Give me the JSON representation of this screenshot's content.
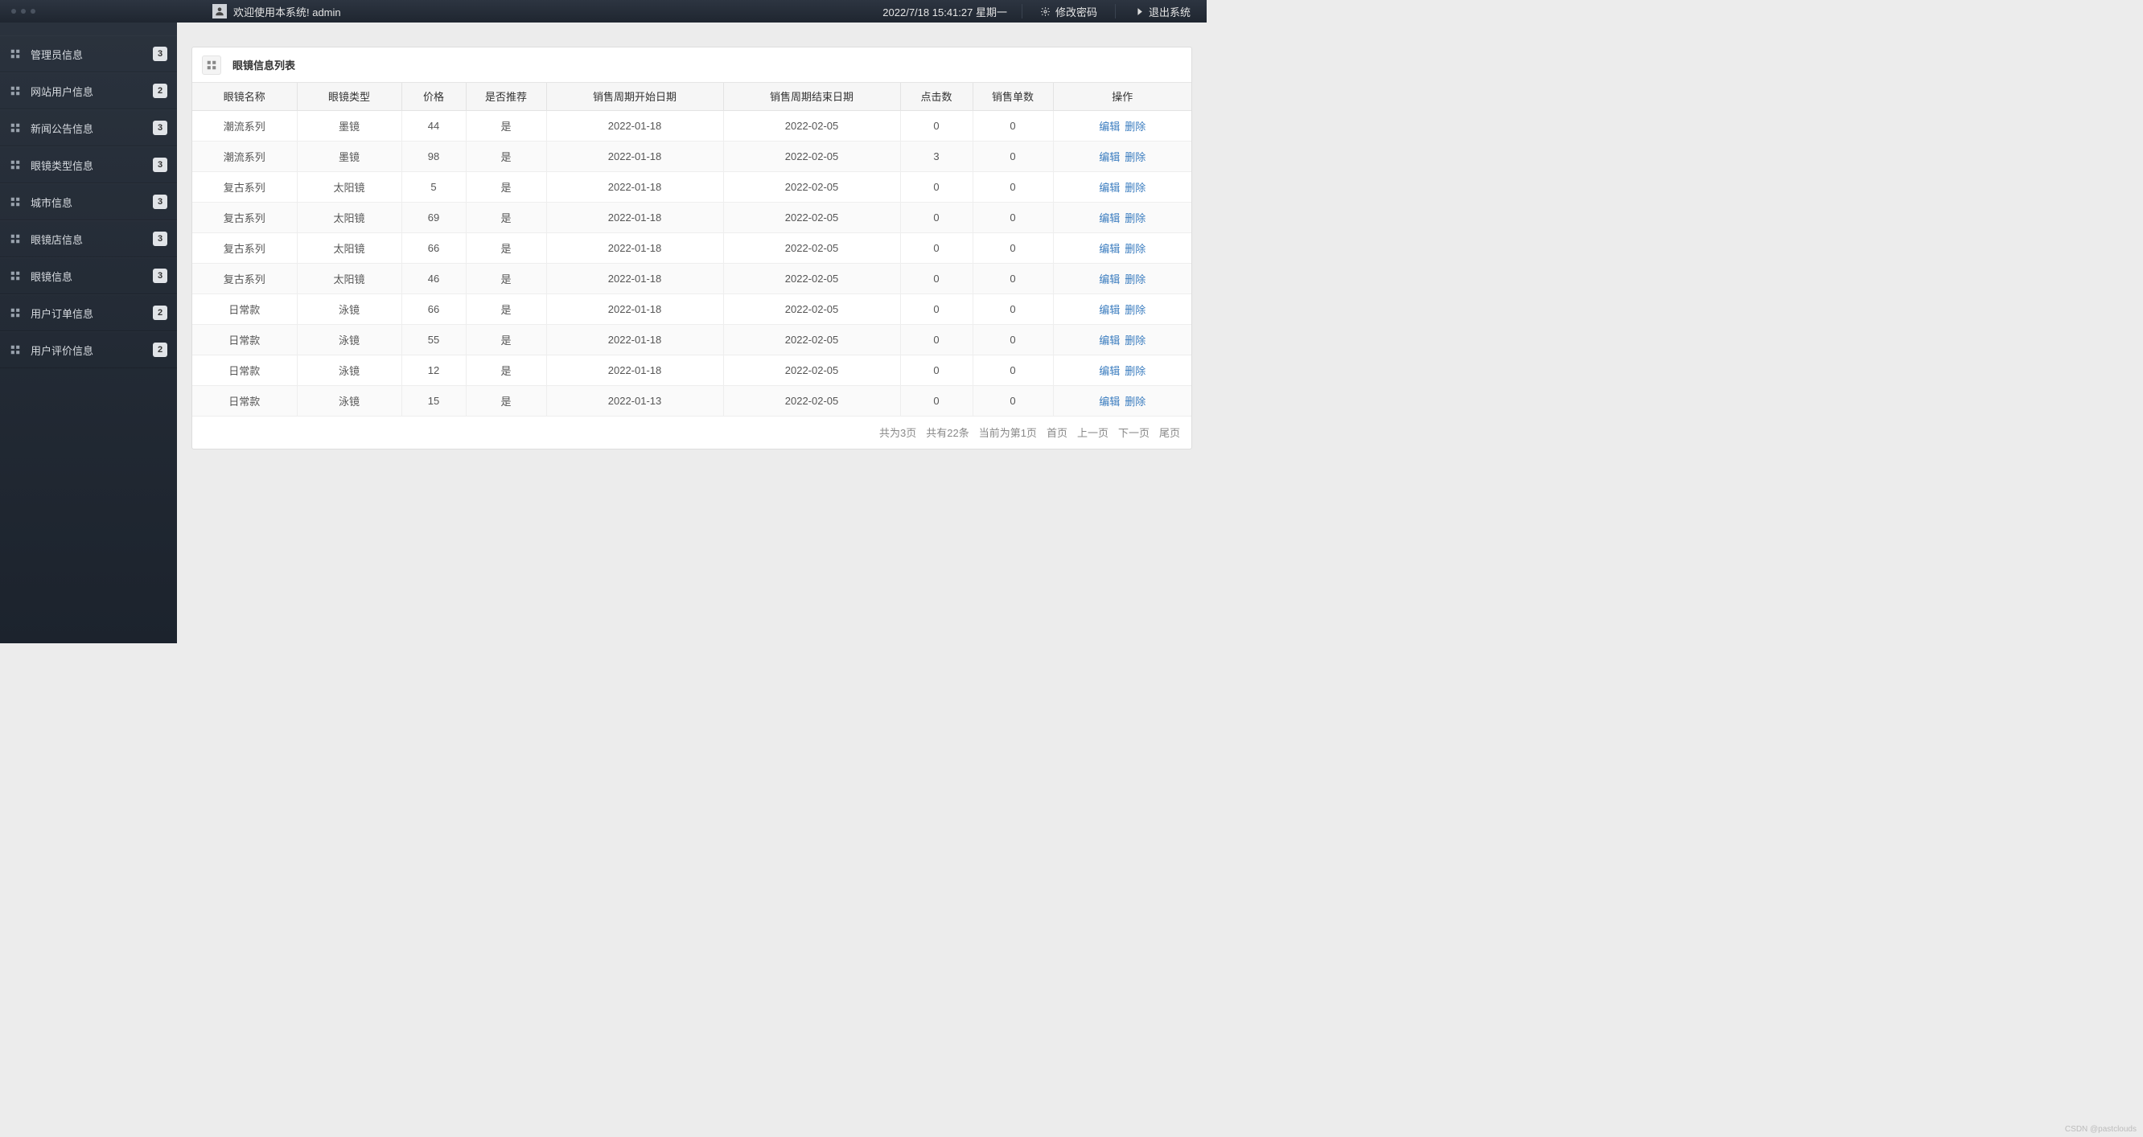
{
  "topbar": {
    "welcome": "欢迎使用本系统! admin",
    "datetime": "2022/7/18 15:41:27 星期一",
    "change_pw": "修改密码",
    "logout": "退出系统"
  },
  "sidebar": {
    "items": [
      {
        "label": "管理员信息",
        "badge": "3"
      },
      {
        "label": "网站用户信息",
        "badge": "2"
      },
      {
        "label": "新闻公告信息",
        "badge": "3"
      },
      {
        "label": "眼镜类型信息",
        "badge": "3"
      },
      {
        "label": "城市信息",
        "badge": "3"
      },
      {
        "label": "眼镜店信息",
        "badge": "3"
      },
      {
        "label": "眼镜信息",
        "badge": "3"
      },
      {
        "label": "用户订单信息",
        "badge": "2"
      },
      {
        "label": "用户评价信息",
        "badge": "2"
      }
    ]
  },
  "panel": {
    "title": "眼镜信息列表"
  },
  "table": {
    "headers": [
      "眼镜名称",
      "眼镜类型",
      "价格",
      "是否推荐",
      "销售周期开始日期",
      "销售周期结束日期",
      "点击数",
      "销售单数",
      "操作"
    ],
    "edit_label": "编辑",
    "delete_label": "删除",
    "rows": [
      {
        "name": "潮流系列",
        "type": "墨镜",
        "price": "44",
        "rec": "是",
        "start": "2022-01-18",
        "end": "2022-02-05",
        "clicks": "0",
        "sold": "0"
      },
      {
        "name": "潮流系列",
        "type": "墨镜",
        "price": "98",
        "rec": "是",
        "start": "2022-01-18",
        "end": "2022-02-05",
        "clicks": "3",
        "sold": "0"
      },
      {
        "name": "复古系列",
        "type": "太阳镜",
        "price": "5",
        "rec": "是",
        "start": "2022-01-18",
        "end": "2022-02-05",
        "clicks": "0",
        "sold": "0"
      },
      {
        "name": "复古系列",
        "type": "太阳镜",
        "price": "69",
        "rec": "是",
        "start": "2022-01-18",
        "end": "2022-02-05",
        "clicks": "0",
        "sold": "0"
      },
      {
        "name": "复古系列",
        "type": "太阳镜",
        "price": "66",
        "rec": "是",
        "start": "2022-01-18",
        "end": "2022-02-05",
        "clicks": "0",
        "sold": "0"
      },
      {
        "name": "复古系列",
        "type": "太阳镜",
        "price": "46",
        "rec": "是",
        "start": "2022-01-18",
        "end": "2022-02-05",
        "clicks": "0",
        "sold": "0"
      },
      {
        "name": "日常款",
        "type": "泳镜",
        "price": "66",
        "rec": "是",
        "start": "2022-01-18",
        "end": "2022-02-05",
        "clicks": "0",
        "sold": "0"
      },
      {
        "name": "日常款",
        "type": "泳镜",
        "price": "55",
        "rec": "是",
        "start": "2022-01-18",
        "end": "2022-02-05",
        "clicks": "0",
        "sold": "0"
      },
      {
        "name": "日常款",
        "type": "泳镜",
        "price": "12",
        "rec": "是",
        "start": "2022-01-18",
        "end": "2022-02-05",
        "clicks": "0",
        "sold": "0"
      },
      {
        "name": "日常款",
        "type": "泳镜",
        "price": "15",
        "rec": "是",
        "start": "2022-01-13",
        "end": "2022-02-05",
        "clicks": "0",
        "sold": "0"
      }
    ]
  },
  "pager": {
    "total_pages": "共为3页",
    "total_items": "共有22条",
    "current": "当前为第1页",
    "first": "首页",
    "prev": "上一页",
    "next": "下一页",
    "last": "尾页"
  },
  "watermark": "CSDN @pastclouds"
}
